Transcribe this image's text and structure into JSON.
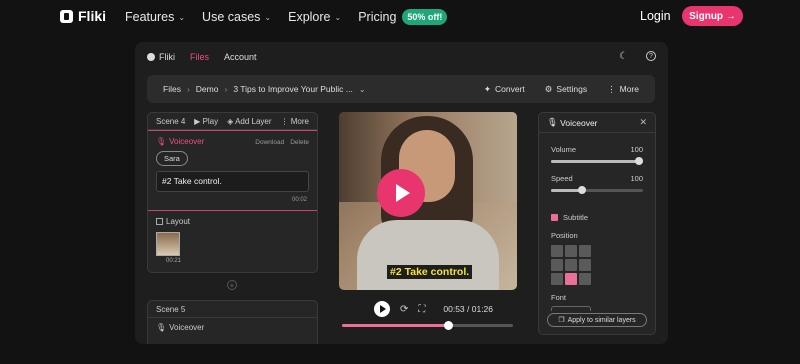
{
  "site": {
    "brand": "Fliki",
    "nav": [
      {
        "label": "Features",
        "dropdown": true
      },
      {
        "label": "Use cases",
        "dropdown": true
      },
      {
        "label": "Explore",
        "dropdown": true
      },
      {
        "label": "Pricing",
        "dropdown": false
      }
    ],
    "pricing_badge": "50% off!",
    "login": "Login",
    "signup": "Signup →"
  },
  "app": {
    "tabs": [
      "Fliki",
      "Files",
      "Account"
    ],
    "active_tab": "Files",
    "breadcrumb": [
      "Files",
      "Demo",
      "3 Tips to Improve Your Public ..."
    ],
    "actions": [
      "Convert",
      "Settings",
      "More"
    ],
    "scene4": {
      "title": "Scene 4",
      "actions": [
        "Play",
        "Add Layer",
        "More"
      ],
      "voiceover": {
        "title": "Voiceover",
        "download": "Download",
        "delete": "Delete",
        "voice": "Sara",
        "text": "#2 Take control.",
        "duration": "00:02"
      },
      "layout": {
        "title": "Layout",
        "thumb_time": "00:21"
      }
    },
    "scene5": {
      "title": "Scene 5",
      "voiceover": "Voiceover"
    },
    "video": {
      "caption": "#2 Take control.",
      "time": "00:53 / 01:26",
      "progress": 0.62
    },
    "props": {
      "title": "Voiceover",
      "volume_label": "Volume",
      "volume_value": "100",
      "volume": 1.0,
      "speed_label": "Speed",
      "speed_value": "100",
      "speed": 0.34,
      "subtitle_label": "Subtitle",
      "subtitle_checked": true,
      "position_label": "Position",
      "position_active_index": 7,
      "font_label": "Font",
      "apply_button": "Apply to similar layers"
    }
  },
  "colors": {
    "accent": "#e8356e",
    "badge": "#1fa67a",
    "caption": "#f5e33a"
  }
}
